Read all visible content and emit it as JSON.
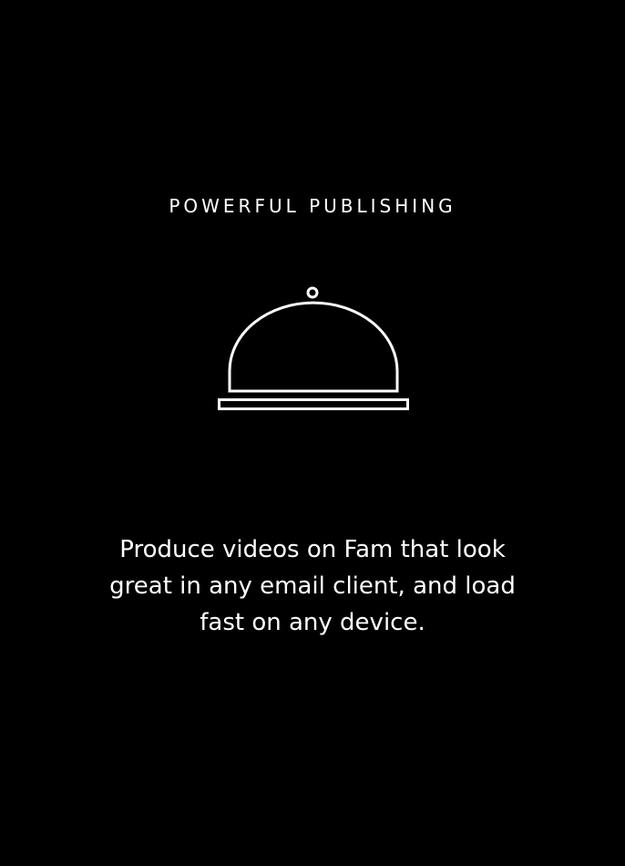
{
  "feature": {
    "eyebrow": "POWERFUL PUBLISHING",
    "icon": "serving-cloche-icon",
    "description": "Produce videos on Fam that look great in any email client, and load fast on any device."
  },
  "colors": {
    "background": "#000000",
    "foreground": "#ffffff"
  }
}
